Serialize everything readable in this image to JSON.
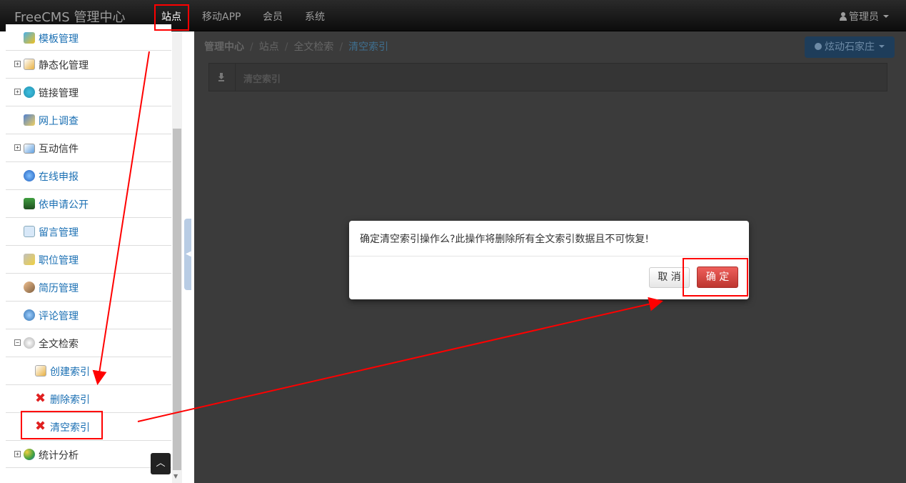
{
  "navbar": {
    "brand": "FreeCMS 管理中心",
    "items": [
      {
        "label": "站点",
        "active": true
      },
      {
        "label": "移动APP",
        "active": false
      },
      {
        "label": "会员",
        "active": false
      },
      {
        "label": "系统",
        "active": false
      }
    ],
    "user_menu_label": "管理员",
    "user_icon": "user-icon"
  },
  "sidebar": {
    "items": [
      {
        "label": "模板管理",
        "icon": "template-icon"
      },
      {
        "label": "静态化管理",
        "icon": "static-pages-icon",
        "expandable": true
      },
      {
        "label": "链接管理",
        "icon": "link-icon",
        "expandable": true
      },
      {
        "label": "网上调查",
        "icon": "survey-icon"
      },
      {
        "label": "互动信件",
        "icon": "letter-icon",
        "expandable": true
      },
      {
        "label": "在线申报",
        "icon": "online-declare-icon"
      },
      {
        "label": "依申请公开",
        "icon": "disclosure-request-icon"
      },
      {
        "label": "留言管理",
        "icon": "message-icon"
      },
      {
        "label": "职位管理",
        "icon": "job-icon"
      },
      {
        "label": "简历管理",
        "icon": "resume-icon"
      },
      {
        "label": "评论管理",
        "icon": "comment-icon"
      },
      {
        "label": "全文检索",
        "icon": "fulltext-search-icon",
        "expandable": true,
        "expanded": true
      },
      {
        "label": "创建索引",
        "icon": "create-index-icon",
        "child": true
      },
      {
        "label": "删除索引",
        "icon": "delete-icon",
        "child": true
      },
      {
        "label": "清空索引",
        "icon": "delete-icon",
        "child": true
      },
      {
        "label": "统计分析",
        "icon": "statistics-icon",
        "expandable": true
      }
    ],
    "expander_collapsed": "+",
    "expander_expanded": "−",
    "back_to_top_icon": "chevron-up-icon"
  },
  "main": {
    "breadcrumb": {
      "home": "管理中心",
      "separator": "/",
      "items": [
        "站点",
        "全文检索"
      ],
      "current": "清空索引"
    },
    "site_button_label": "炫动石家庄",
    "panel_title": "清空索引"
  },
  "modal": {
    "message": "确定清空索引操作么?此操作将删除所有全文索引数据且不可恢复!",
    "cancel_label": "取 消",
    "ok_label": "确 定"
  },
  "colors": {
    "navbar": "#0c0c0c",
    "link": "#1a6fb3",
    "ok_button": "#bd362f",
    "annotation": "#ff0000"
  }
}
